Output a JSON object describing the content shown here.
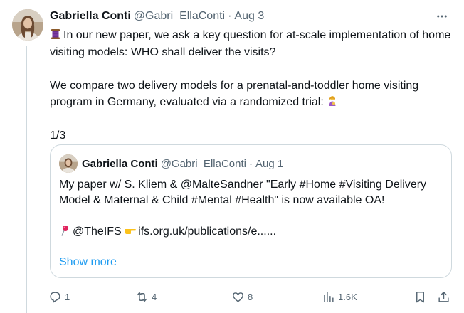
{
  "tweet": {
    "author": {
      "display_name": "Gabriella Conti",
      "handle": "@Gabri_EllaConti",
      "separator": "·",
      "date": "Aug 3"
    },
    "icons": {
      "lead_emoji": "thread-spool-icon",
      "end_emoji": "woman-feeding-baby-icon",
      "menu": "more-horizontal-icon"
    },
    "paragraphs": [
      "In our new paper, we ask a key question for at-scale implementation of home visiting models: WHO shall deliver the visits?",
      "We compare two delivery models for a prenatal-and-toddler home visiting program in Germany, evaluated via a randomized trial:",
      "1/3"
    ],
    "quoted": {
      "author": {
        "display_name": "Gabriella Conti",
        "handle": "@Gabri_EllaConti",
        "separator": "·",
        "date": "Aug 1"
      },
      "text": "My paper w/ S. Kliem & @MalteSandner \"Early #Home #Visiting Delivery Model & Maternal & Child #Mental #Health\" is now available OA!",
      "link_prefix": "@TheIFS",
      "link": "ifs.org.uk/publications/e......",
      "show_more": "Show more",
      "icons": {
        "pin": "round-pushpin-icon",
        "point": "backhand-pointing-right-icon"
      }
    },
    "actions": {
      "reply": "1",
      "repost": "4",
      "like": "8",
      "views": "1.6K"
    },
    "colors": {
      "text": "#0f1419",
      "secondary": "#536471",
      "link": "#1d9bf0",
      "border": "#cfd9de"
    }
  }
}
